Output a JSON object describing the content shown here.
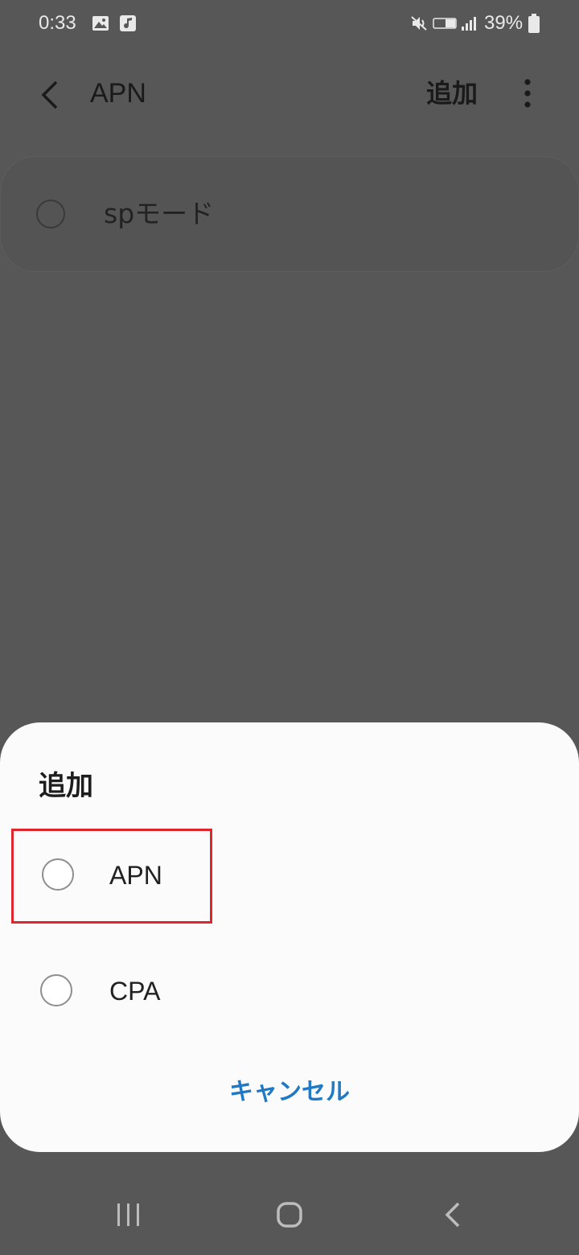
{
  "status_bar": {
    "time": "0:33",
    "battery": "39%",
    "icons": [
      "gallery-icon",
      "music-icon",
      "mute-icon",
      "volte-icon",
      "signal-icon",
      "battery-icon"
    ]
  },
  "app_bar": {
    "title": "APN",
    "add_label": "追加"
  },
  "apn_list": [
    {
      "name": "spモード"
    }
  ],
  "dialog": {
    "title": "追加",
    "options": [
      {
        "label": "APN"
      },
      {
        "label": "CPA"
      }
    ],
    "cancel_label": "キャンセル"
  },
  "colors": {
    "scrim_background": "#575757",
    "dialog_background": "#fbfbfb",
    "cancel_text": "#2179c4",
    "highlight_border": "#e0262c"
  }
}
